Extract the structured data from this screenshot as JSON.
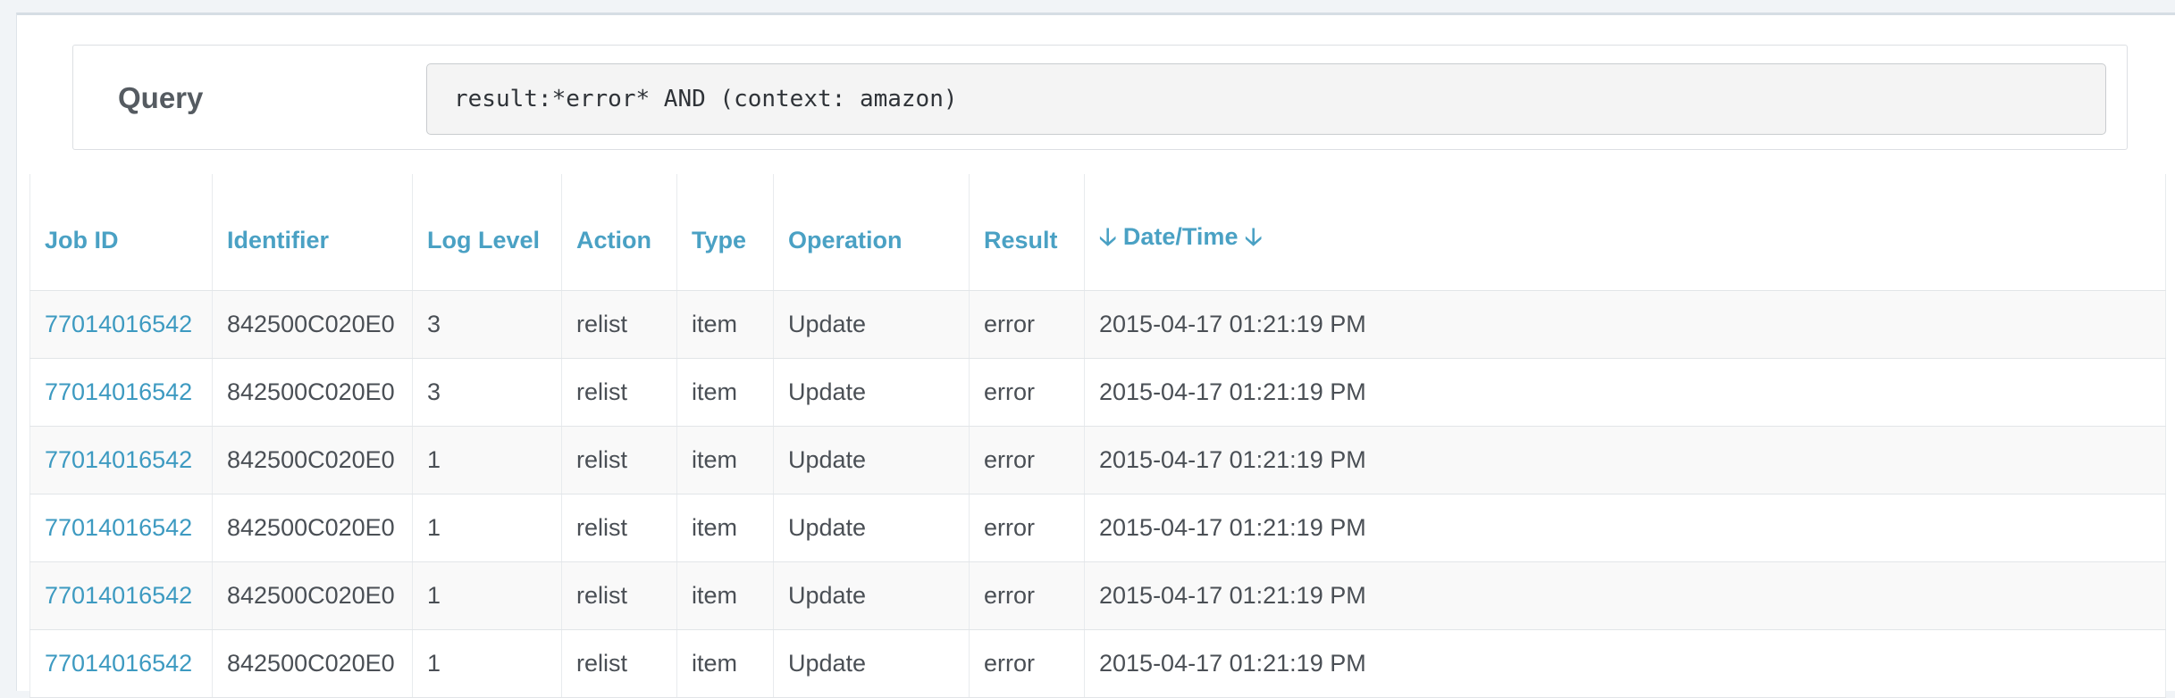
{
  "query": {
    "label": "Query",
    "value": "result:*error* AND (context: amazon)"
  },
  "table": {
    "columns": [
      "Job ID",
      "Identifier",
      "Log Level",
      "Action",
      "Type",
      "Operation",
      "Result",
      "Date/Time"
    ],
    "sort_icon": "arrow-down-icon",
    "rows": [
      {
        "job_id": "77014016542",
        "identifier": "842500C020E0",
        "log_level": "3",
        "action": "relist",
        "type": "item",
        "operation": "Update",
        "result": "error",
        "datetime": "2015-04-17 01:21:19 PM"
      },
      {
        "job_id": "77014016542",
        "identifier": "842500C020E0",
        "log_level": "3",
        "action": "relist",
        "type": "item",
        "operation": "Update",
        "result": "error",
        "datetime": "2015-04-17 01:21:19 PM"
      },
      {
        "job_id": "77014016542",
        "identifier": "842500C020E0",
        "log_level": "1",
        "action": "relist",
        "type": "item",
        "operation": "Update",
        "result": "error",
        "datetime": "2015-04-17 01:21:19 PM"
      },
      {
        "job_id": "77014016542",
        "identifier": "842500C020E0",
        "log_level": "1",
        "action": "relist",
        "type": "item",
        "operation": "Update",
        "result": "error",
        "datetime": "2015-04-17 01:21:19 PM"
      },
      {
        "job_id": "77014016542",
        "identifier": "842500C020E0",
        "log_level": "1",
        "action": "relist",
        "type": "item",
        "operation": "Update",
        "result": "error",
        "datetime": "2015-04-17 01:21:19 PM"
      },
      {
        "job_id": "77014016542",
        "identifier": "842500C020E0",
        "log_level": "1",
        "action": "relist",
        "type": "item",
        "operation": "Update",
        "result": "error",
        "datetime": "2015-04-17 01:21:19 PM"
      }
    ]
  },
  "colors": {
    "link": "#3d9ac1",
    "header_text": "#4aa1c4",
    "body_text": "#4a4f55",
    "stripe": "#f9f9f9"
  }
}
